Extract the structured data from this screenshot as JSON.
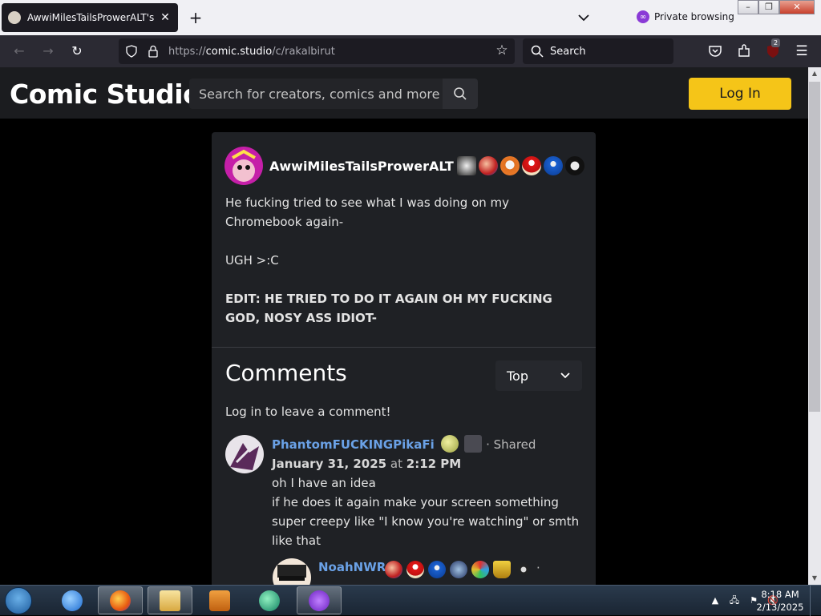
{
  "browser": {
    "tab_title": "AwwiMilesTailsProwerALT's Post",
    "private_label": "Private browsing",
    "url_prefix": "https://",
    "url_domain": "comic.studio",
    "url_path": "/c/rakalbirut",
    "search_placeholder": "Search",
    "extension_badge": "2"
  },
  "site": {
    "logo": "Comic Studio",
    "search_placeholder": "Search for creators, comics and more",
    "login_label": "Log In",
    "accent_color": "#f5c518"
  },
  "post": {
    "username": "AwwiMilesTailsProwerALT",
    "body_lines": [
      "He fucking tried to see what I was doing on my Chromebook again-",
      "UGH >:C"
    ],
    "edit_text": "EDIT: HE TRIED TO DO IT AGAIN OH MY FUCKING GOD, NOSY ASS IDIOT-"
  },
  "comments": {
    "title": "Comments",
    "sort_value": "Top",
    "login_prompt": "Log in to leave a comment!",
    "items": [
      {
        "username": "PhantomFUCKINGPikaFi",
        "shared_label": "· Shared",
        "date": "January 31, 2025",
        "at_label": "at",
        "time": "2:12 PM",
        "lines": [
          "oh I have an idea",
          "if he does it again make your screen something super creepy like \"I know you're watching\" or smth like that"
        ]
      }
    ],
    "reply": {
      "username": "NoahNWR",
      "trailing": "·"
    }
  },
  "taskbar": {
    "time": "8:18 AM",
    "date": "2/13/2025"
  }
}
